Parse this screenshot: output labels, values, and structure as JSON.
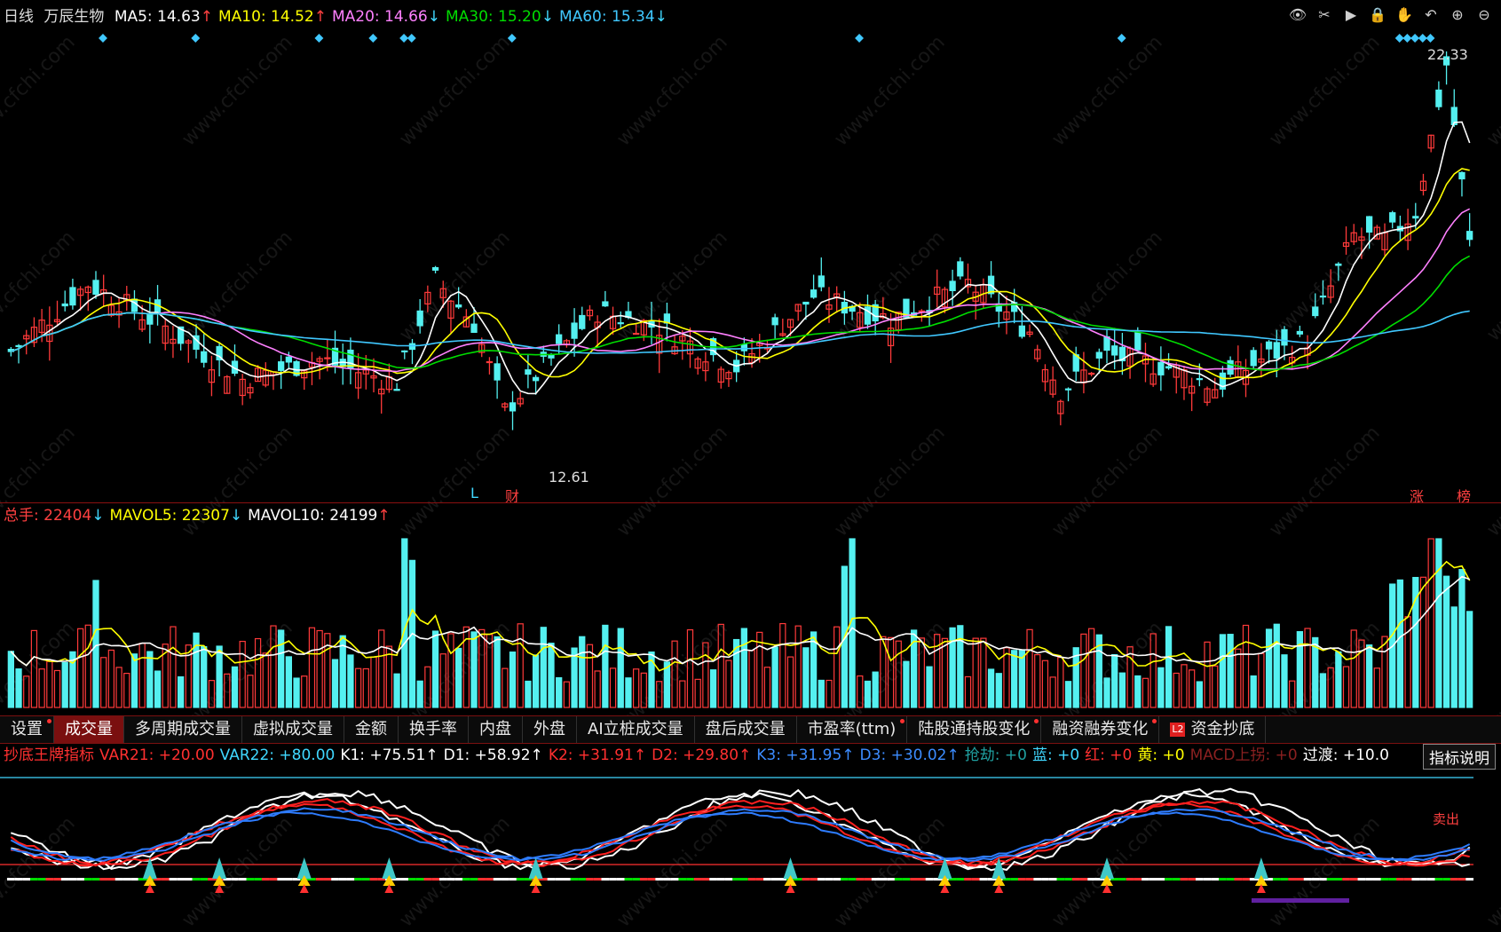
{
  "header": {
    "period": "日线",
    "stock": "万辰生物",
    "ma": [
      {
        "label": "MA5:",
        "value": "14.63",
        "arrow": "↑",
        "color": "#ffffff"
      },
      {
        "label": "MA10:",
        "value": "14.52",
        "arrow": "↑",
        "color": "#ffff00"
      },
      {
        "label": "MA20:",
        "value": "14.66",
        "arrow": "↓",
        "color": "#ff80ff"
      },
      {
        "label": "MA30:",
        "value": "15.20",
        "arrow": "↓",
        "color": "#00dd00"
      },
      {
        "label": "MA60:",
        "value": "15.34",
        "arrow": "↓",
        "color": "#40c8ff"
      }
    ]
  },
  "toolbar": [
    "eye-icon",
    "scissors-icon",
    "play-icon",
    "lock-icon",
    "hand-icon",
    "undo-icon",
    "zoom-in-icon",
    "zoom-out-icon"
  ],
  "price": {
    "high_label": "22.33",
    "low_label": "12.61",
    "mark_L": "L",
    "mark_cai": "财",
    "mark_zhang": "涨",
    "mark_bang": "榜"
  },
  "volume_header": [
    {
      "label": "总手:",
      "value": "22404",
      "arrow": "↓",
      "color": "#ff4040"
    },
    {
      "label": "MAVOL5:",
      "value": "22307",
      "arrow": "↓",
      "color": "#ffff00"
    },
    {
      "label": "MAVOL10:",
      "value": "24199",
      "arrow": "↑",
      "color": "#ffffff"
    }
  ],
  "tabs": [
    {
      "label": "设置",
      "dot": true
    },
    {
      "label": "成交量",
      "active": true
    },
    {
      "label": "多周期成交量"
    },
    {
      "label": "虚拟成交量"
    },
    {
      "label": "金额"
    },
    {
      "label": "换手率"
    },
    {
      "label": "内盘"
    },
    {
      "label": "外盘"
    },
    {
      "label": "AI立桩成交量"
    },
    {
      "label": "盘后成交量"
    },
    {
      "label": "市盈率(ttm)",
      "dot": true
    },
    {
      "label": "陆股通持股变化",
      "dot": true
    },
    {
      "label": "融资融券变化",
      "dot": true
    },
    {
      "label": "资金抄底",
      "l2": "L2"
    }
  ],
  "indicator_header": [
    {
      "label": "抄底王牌指标",
      "value": "",
      "color": "#ff3030"
    },
    {
      "label": "VAR21:",
      "value": "+20.00",
      "color": "#ff3030"
    },
    {
      "label": "VAR22:",
      "value": "+80.00",
      "color": "#40d8ff"
    },
    {
      "label": "K1:",
      "value": "+75.51↑",
      "color": "#ffffff"
    },
    {
      "label": "D1:",
      "value": "+58.92↑",
      "color": "#ffffff"
    },
    {
      "label": "K2:",
      "value": "+31.91↑",
      "color": "#ff3030"
    },
    {
      "label": "D2:",
      "value": "+29.80↑",
      "color": "#ff3030"
    },
    {
      "label": "K3:",
      "value": "+31.95↑",
      "color": "#3c8cff"
    },
    {
      "label": "D3:",
      "value": "+30.02↑",
      "color": "#3c8cff"
    },
    {
      "label": "抢劫:",
      "value": "+0",
      "color": "#20a0a0"
    },
    {
      "label": "蓝:",
      "value": "+0",
      "color": "#40d8ff"
    },
    {
      "label": "红:",
      "value": "+0",
      "color": "#ff3030"
    },
    {
      "label": "黄:",
      "value": "+0",
      "color": "#ffff00"
    },
    {
      "label": "MACD上拐:",
      "value": "+0",
      "color": "#8a2020"
    },
    {
      "label": "过渡:",
      "value": "+10.0",
      "color": "#ffffff"
    }
  ],
  "help_button": "指标说明",
  "sell_label": "卖出",
  "colors": {
    "up": "#ff3a3a",
    "down": "#54f0f0",
    "ma5": "#ffffff",
    "ma10": "#ffff00",
    "ma20": "#ff80ff",
    "ma30": "#00dd00",
    "ma60": "#40c8ff"
  }
}
